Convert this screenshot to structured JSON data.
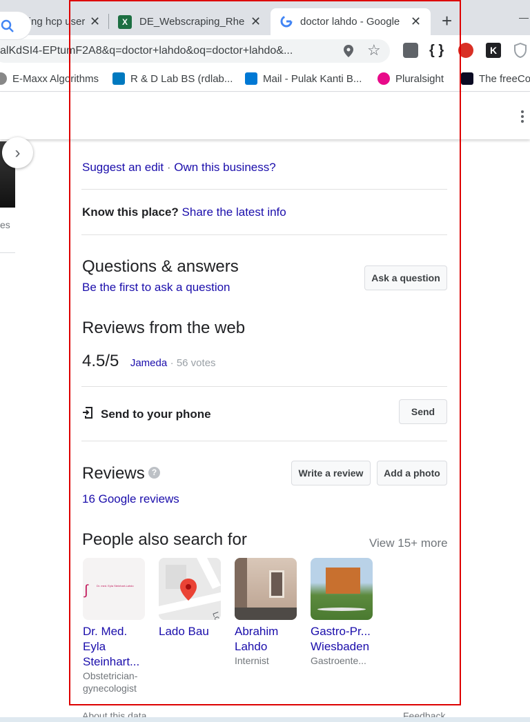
{
  "browser": {
    "tabs": [
      {
        "label": "scraping hcp user",
        "close": "✕"
      },
      {
        "label": "DE_Webscraping_Rheu",
        "close": "✕"
      },
      {
        "label": "doctor lahdo - Google",
        "close": "✕"
      }
    ],
    "new_tab": "+",
    "minimize": "—",
    "address": "alKdSI4-EPtumF2A8&q=doctor+lahdo&oq=doctor+lahdo&...",
    "bookmarks": [
      {
        "label": "E-Maxx Algorithms"
      },
      {
        "label": "R & D Lab BS (rdlab..."
      },
      {
        "label": "Mail - Pulak Kanti B..."
      },
      {
        "label": "Pluralsight"
      },
      {
        "label": "The freeCo"
      }
    ]
  },
  "left_strip": {
    "text": "es",
    "carousel_arrow": "›"
  },
  "panel": {
    "suggest_edit": "Suggest an edit",
    "dot": "·",
    "own_business": "Own this business?",
    "know_place": "Know this place?",
    "share_info": "Share the latest info",
    "qa_title": "Questions & answers",
    "qa_first": "Be the first to ask a question",
    "ask_button": "Ask a question",
    "web_reviews_title": "Reviews from the web",
    "rating": "4.5/5",
    "rating_source": "Jameda",
    "rating_votes": "· 56 votes",
    "send_phone": "Send to your phone",
    "send_button": "Send",
    "reviews_title": "Reviews",
    "write_review": "Write a review",
    "add_photo": "Add a photo",
    "google_reviews": "16 Google reviews",
    "people_title": "People also search for",
    "view_more": "View 15+ more",
    "people": [
      {
        "name": "Dr. Med. Eyla Steinhart...",
        "desc": "Obstetrician-gynecologist",
        "logo_text": "Dr. med. Eyla Steinhart-Lahdo"
      },
      {
        "name": "Lado Bau",
        "desc": "",
        "map_text": "Lo"
      },
      {
        "name": "Abrahim Lahdo",
        "desc": "Internist"
      },
      {
        "name": "Gastro-Pr... Wiesbaden",
        "desc": "Gastroente..."
      }
    ],
    "about_data": "About this data",
    "feedback": "Feedback"
  }
}
